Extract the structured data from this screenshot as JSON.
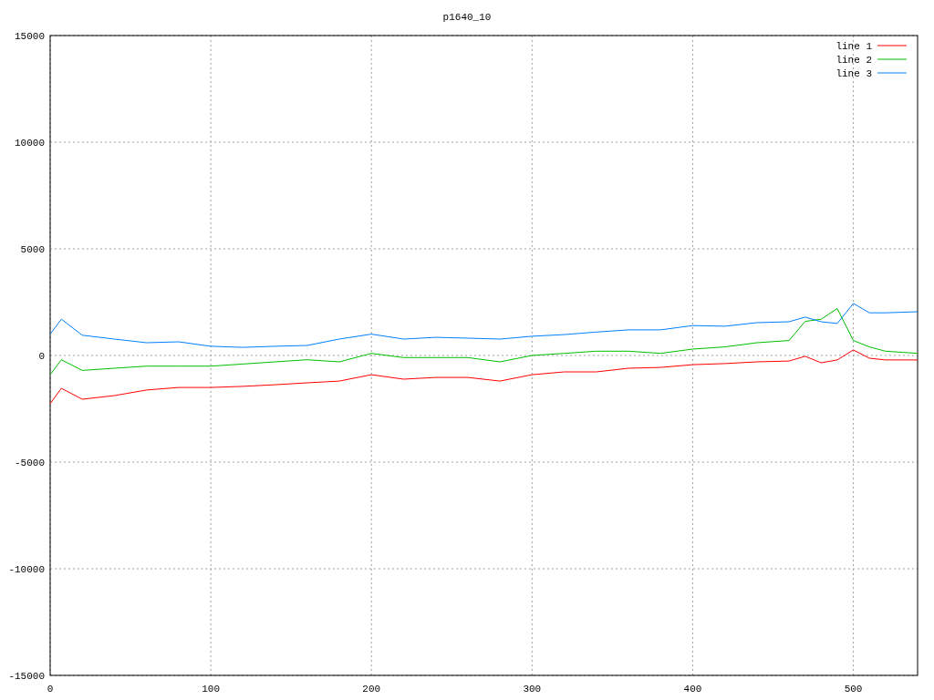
{
  "chart": {
    "chart_data": {
      "type": "line",
      "title": "p1640_10",
      "x": [
        0,
        7,
        20,
        40,
        60,
        80,
        100,
        120,
        140,
        160,
        180,
        200,
        220,
        240,
        260,
        280,
        300,
        320,
        340,
        360,
        380,
        400,
        420,
        440,
        460,
        470,
        480,
        490,
        500,
        510,
        520,
        540
      ],
      "series": [
        {
          "name": "line 1",
          "color": "#ff0000",
          "values": [
            -2260,
            -1540,
            -2050,
            -1880,
            -1620,
            -1500,
            -1500,
            -1450,
            -1370,
            -1280,
            -1200,
            -900,
            -1110,
            -1030,
            -1030,
            -1200,
            -900,
            -770,
            -770,
            -600,
            -560,
            -430,
            -380,
            -300,
            -260,
            -40,
            -340,
            -210,
            260,
            -130,
            -210,
            -210
          ]
        },
        {
          "name": "line 2",
          "color": "#00c000",
          "values": [
            -900,
            -200,
            -700,
            -600,
            -500,
            -500,
            -500,
            -400,
            -300,
            -200,
            -300,
            100,
            -100,
            -100,
            -100,
            -300,
            0,
            100,
            200,
            200,
            100,
            300,
            400,
            600,
            700,
            1600,
            1700,
            2200,
            700,
            400,
            200,
            100
          ]
        },
        {
          "name": "line 3",
          "color": "#0080ff",
          "values": [
            1000,
            1700,
            950,
            770,
            600,
            640,
            430,
            380,
            430,
            470,
            770,
            1000,
            770,
            850,
            810,
            770,
            900,
            980,
            1100,
            1200,
            1200,
            1400,
            1370,
            1540,
            1580,
            1800,
            1580,
            1500,
            2440,
            2000,
            2000,
            2050
          ]
        }
      ],
      "xlim": [
        0,
        540
      ],
      "ylim": [
        -15000,
        15000
      ],
      "xticks": [
        0,
        100,
        200,
        300,
        400,
        500
      ],
      "yticks": [
        -15000,
        -10000,
        -5000,
        0,
        5000,
        10000,
        15000
      ],
      "grid": true,
      "legend": true
    }
  }
}
